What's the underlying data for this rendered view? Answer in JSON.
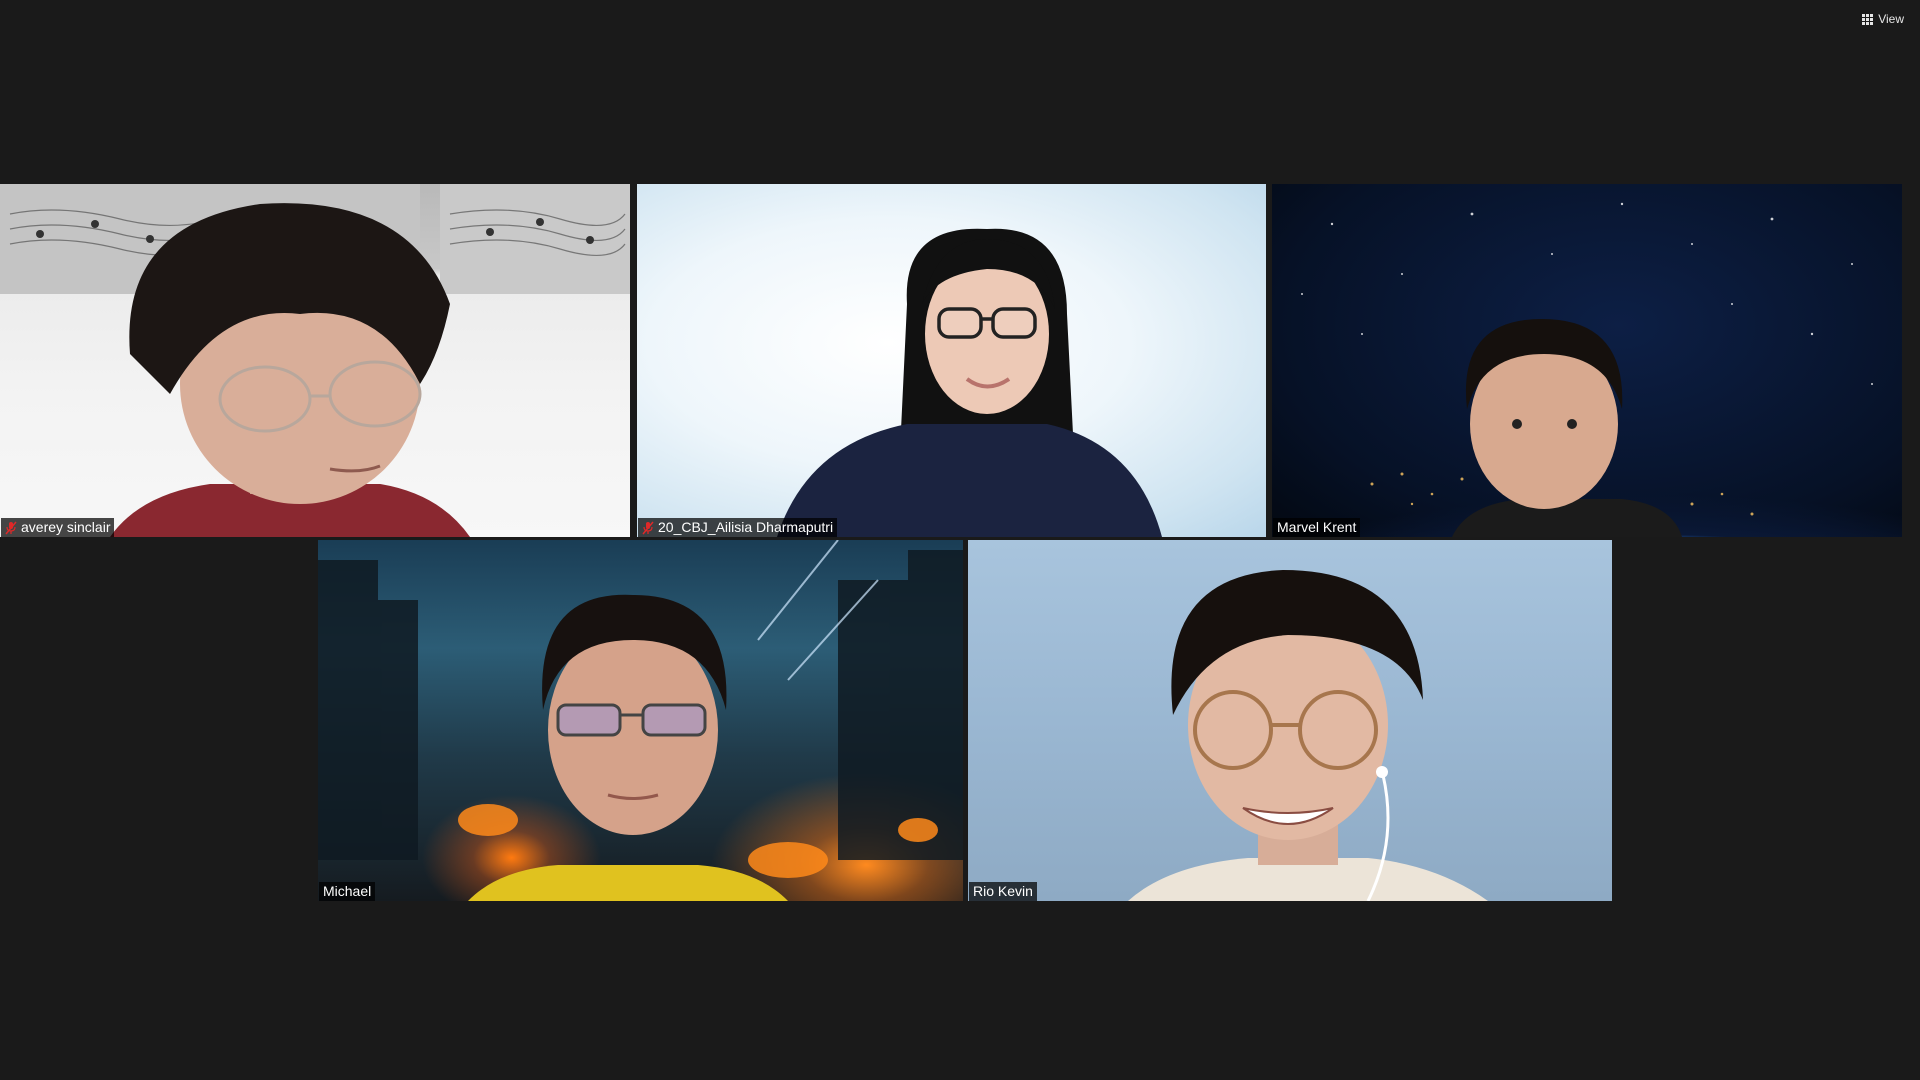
{
  "toolbar": {
    "view_label": "View",
    "view_icon": "grid-icon"
  },
  "participants": [
    {
      "name": "averey sinclair",
      "muted": true
    },
    {
      "name": "20_CBJ_Ailisia Dharmaputri",
      "muted": true
    },
    {
      "name": "Marvel Krent",
      "muted": false
    },
    {
      "name": "Michael",
      "muted": false
    },
    {
      "name": "Rio Kevin",
      "muted": false
    }
  ],
  "colors": {
    "background": "#1a1a1a",
    "muted_icon": "#e02828",
    "name_tag_bg": "#000000"
  }
}
